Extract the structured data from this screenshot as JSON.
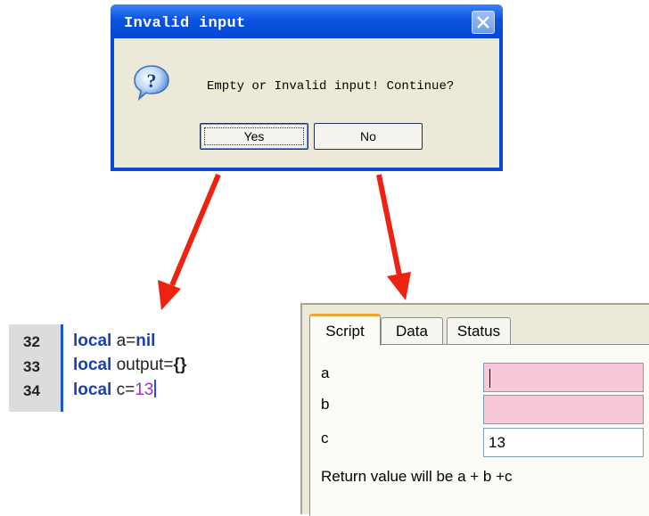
{
  "dialog": {
    "title": "Invalid input",
    "message": "Empty or Invalid input! Continue?",
    "yes_label": "Yes",
    "no_label": "No",
    "icon": "question-icon"
  },
  "code": {
    "lines": [
      {
        "number": "32",
        "keyword": "local",
        "rest_a": " a=",
        "rest_b": "nil"
      },
      {
        "number": "33",
        "keyword": "local",
        "rest_a": " output=",
        "rest_b": "{}"
      },
      {
        "number": "34",
        "keyword": "local",
        "rest_a": " c=",
        "rest_b": "13"
      }
    ]
  },
  "panel": {
    "tabs": [
      {
        "label": "Script",
        "active": true
      },
      {
        "label": "Data",
        "active": false
      },
      {
        "label": "Status",
        "active": false
      }
    ],
    "fields": [
      {
        "label": "a",
        "value": ""
      },
      {
        "label": "b",
        "value": ""
      },
      {
        "label": "c",
        "value": "13"
      }
    ],
    "return_text": "Return value will be a + b +c"
  },
  "colors": {
    "arrow": "#ee2211",
    "invalid_field": "#f7c8da",
    "keyword": "#1a3fb5",
    "number": "#a030c0"
  }
}
